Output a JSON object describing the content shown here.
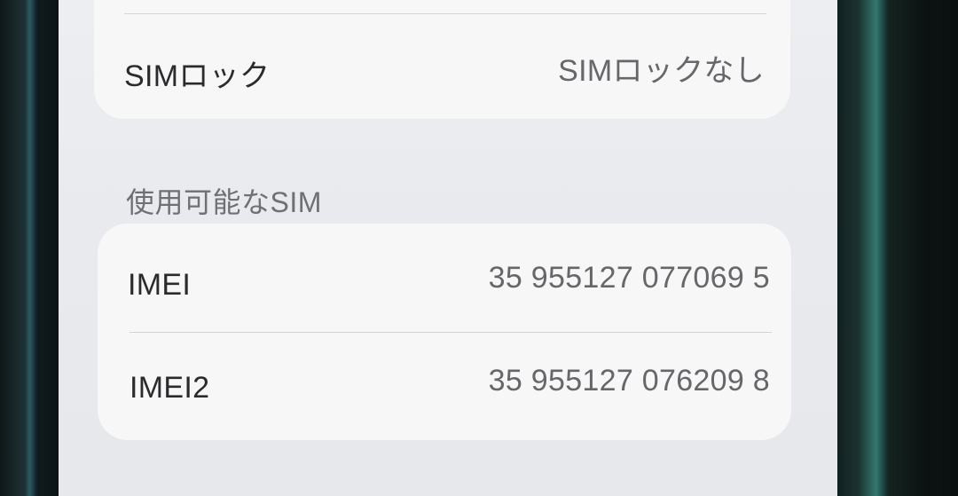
{
  "sim_lock": {
    "label": "SIMロック",
    "value": "SIMロックなし"
  },
  "available_sim": {
    "header": "使用可能なSIM",
    "rows": [
      {
        "label": "IMEI",
        "value": "35 955127 077069 5"
      },
      {
        "label": "IMEI2",
        "value": "35 955127 076209 8"
      }
    ]
  }
}
